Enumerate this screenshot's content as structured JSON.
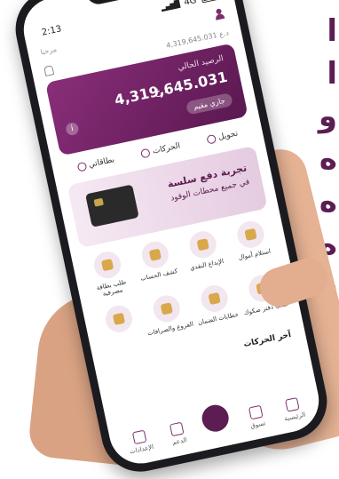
{
  "background": {
    "side_letters": [
      "ا",
      "ا",
      "و",
      "ه",
      "ه",
      "ه",
      "-",
      "-"
    ]
  },
  "phone": {
    "status_bar": {
      "time": "2:13",
      "network": "4G"
    },
    "top_bar": {
      "greeting": "مرحبا"
    },
    "small_balance": "4,319,645.031 د.ع",
    "balance_card": {
      "label": "الرصيد الحالي",
      "amount": "4,319,645.031",
      "currency": "د.ع",
      "account_chip": "جاري مقيم"
    },
    "quick_actions": [
      {
        "label": "تحويل",
        "icon": "transfer-icon"
      },
      {
        "label": "الحركات",
        "icon": "clock-icon"
      },
      {
        "label": "بطاقاتي",
        "icon": "card-icon"
      }
    ],
    "promo": {
      "line1": "تجربة دفع سلسة",
      "line2": "في جميع محطات الوقود"
    },
    "services": [
      {
        "label": "استلام أموال",
        "icon": "money-hand-icon"
      },
      {
        "label": "الإيداع النقدي",
        "icon": "wallet-icon"
      },
      {
        "label": "كشف الحساب",
        "icon": "statement-icon"
      },
      {
        "label": "طلب بطاقة مصرفية",
        "icon": "card-request-icon"
      },
      {
        "label": "طلب دفتر صكوك",
        "icon": "cheque-icon"
      },
      {
        "label": "خطابات الضمان",
        "icon": "guarantee-icon"
      },
      {
        "label": "الفروع والصرافات",
        "icon": "location-icon"
      },
      {
        "label": "",
        "icon": "more-icon"
      }
    ],
    "section_title": "آخر الحركات",
    "bottom_nav": [
      {
        "label": "الرئيسية",
        "icon": "home-icon"
      },
      {
        "label": "تسوق",
        "icon": "cart-icon"
      },
      {
        "label": "",
        "icon": "qr-icon",
        "center": true
      },
      {
        "label": "الدعم",
        "icon": "headset-icon"
      },
      {
        "label": "الإعدادات",
        "icon": "gear-icon"
      }
    ]
  },
  "colors": {
    "brand": "#5b1d52",
    "brand_light": "#8a2e7a",
    "skin": "#d9a283"
  }
}
